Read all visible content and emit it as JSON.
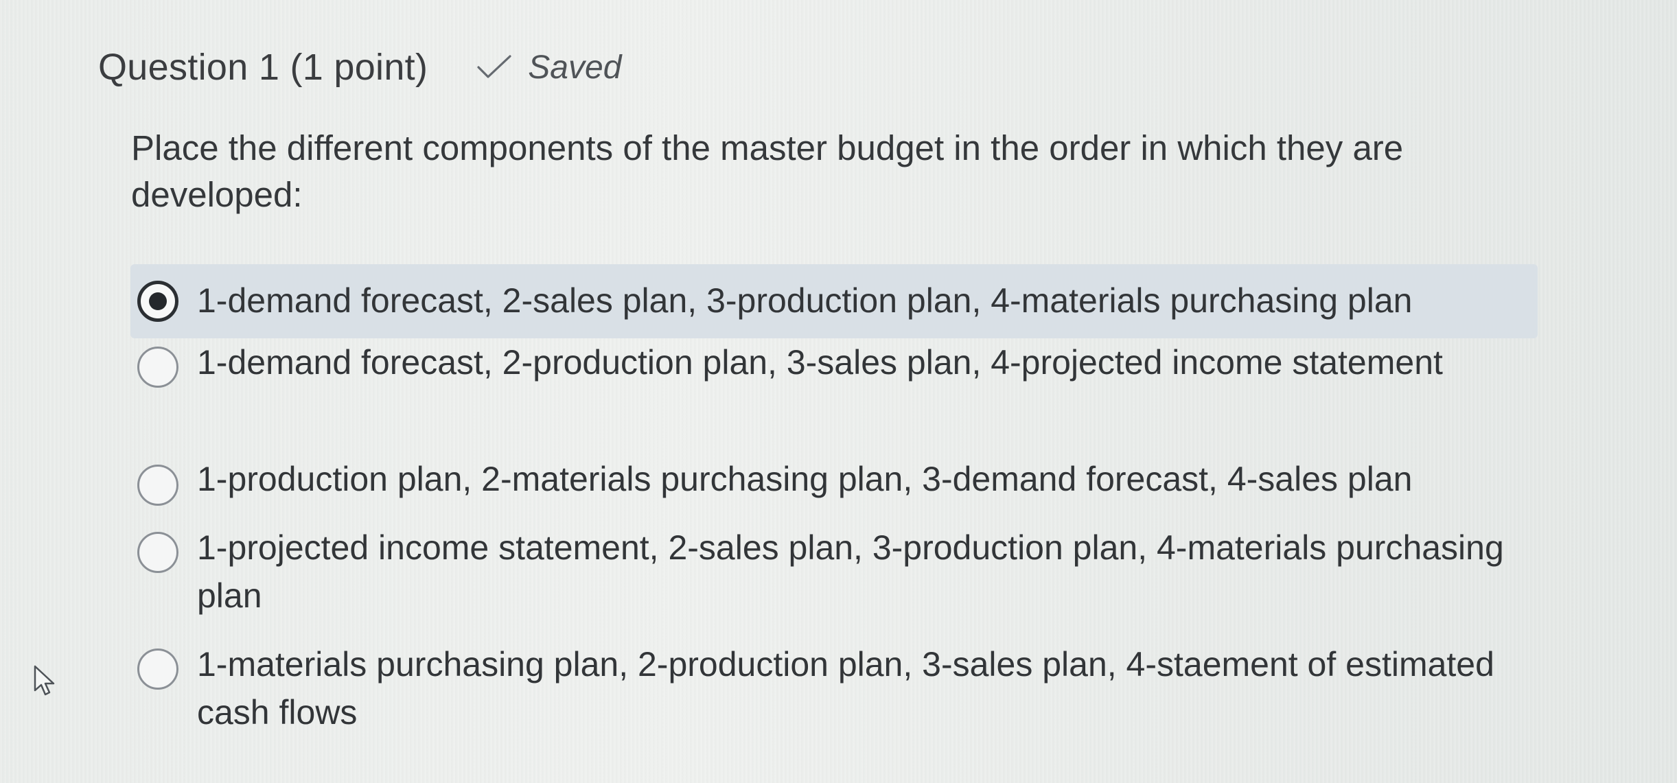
{
  "question": {
    "title": "Question 1 (1 point)",
    "status": {
      "icon": "check-icon",
      "label": "Saved"
    },
    "prompt": "Place the different components of the master budget in the order in which they are developed:"
  },
  "options": [
    {
      "label": "1-demand forecast, 2-sales plan, 3-production plan, 4-materials purchasing plan",
      "selected": true
    },
    {
      "label": "1-demand forecast, 2-production plan, 3-sales plan, 4-projected income statement",
      "selected": false
    },
    {
      "label": "1-production plan, 2-materials purchasing plan, 3-demand forecast, 4-sales plan",
      "selected": false
    },
    {
      "label": "1-projected income statement, 2-sales plan, 3-production plan, 4-materials purchasing plan",
      "selected": false
    },
    {
      "label": "1-materials purchasing plan, 2-production plan, 3-sales plan, 4-staement of estimated cash flows",
      "selected": false
    }
  ],
  "colors": {
    "selected_background": "#d9e0e6",
    "text": "#323538",
    "radio_border": "#8b9096"
  },
  "pointer": {
    "icon": "mouse-pointer-icon"
  }
}
